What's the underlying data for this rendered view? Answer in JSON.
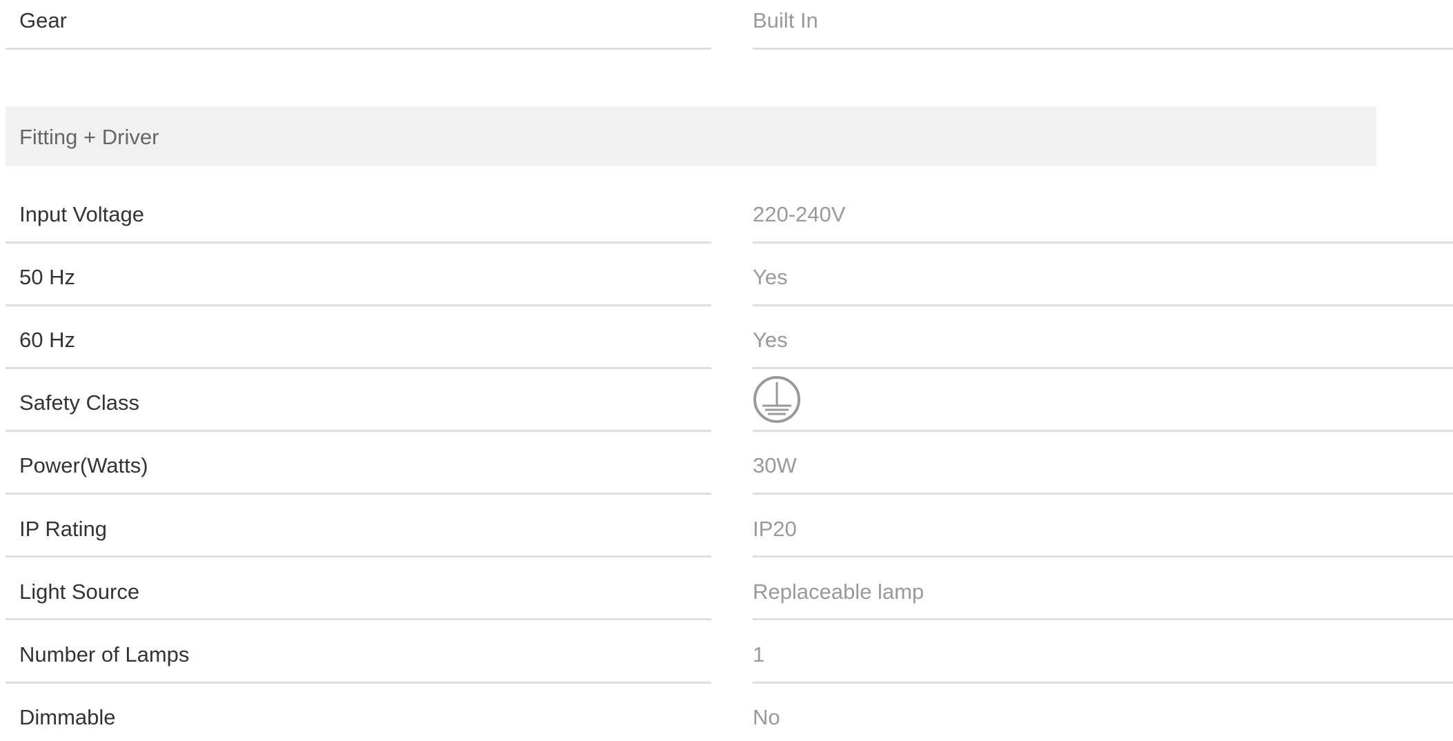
{
  "gear": {
    "label": "Gear",
    "value": "Built In"
  },
  "section": {
    "title": "Fitting + Driver"
  },
  "specs": [
    {
      "label": "Input Voltage",
      "value": "220-240V"
    },
    {
      "label": "50 Hz",
      "value": "Yes"
    },
    {
      "label": "60 Hz",
      "value": "Yes"
    },
    {
      "label": "Safety Class",
      "value": "",
      "icon": "earth-ground-class-1-icon"
    },
    {
      "label": "Power(Watts)",
      "value": "30W"
    },
    {
      "label": "IP Rating",
      "value": "IP20"
    },
    {
      "label": "Light Source",
      "value": "Replaceable lamp"
    },
    {
      "label": "Number of Lamps",
      "value": "1"
    },
    {
      "label": "Dimmable",
      "value": "No"
    }
  ],
  "colors": {
    "label_text": "#333333",
    "value_text": "#999999",
    "section_bg": "#f1f1f1",
    "rule": "#dedede"
  }
}
